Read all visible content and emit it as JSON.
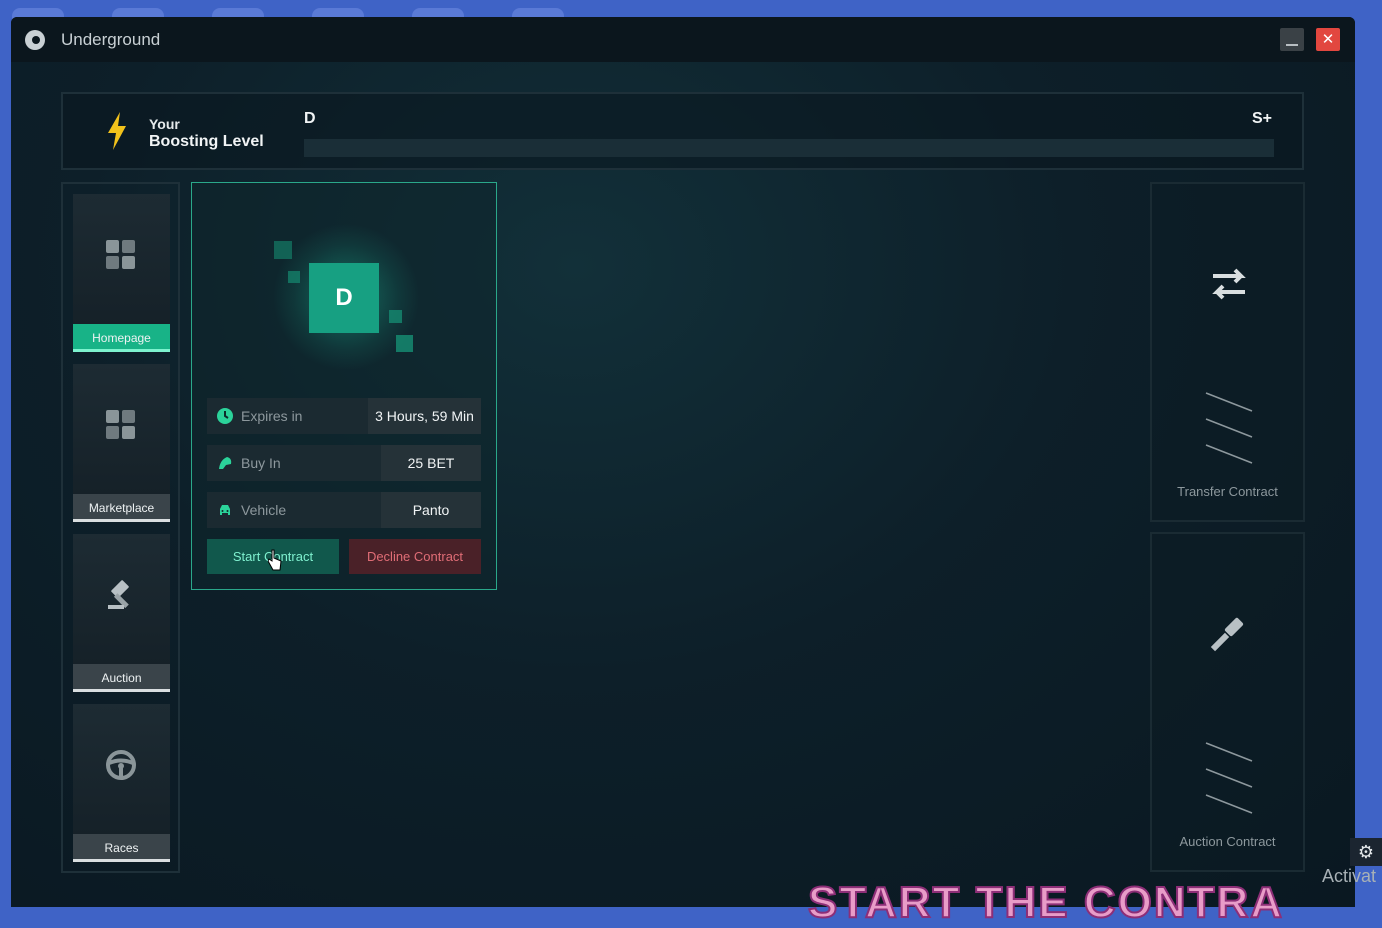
{
  "window": {
    "title": "Underground"
  },
  "boosting": {
    "label_your": "Your",
    "label_title": "Boosting Level",
    "current_level": "D",
    "max_level": "S+",
    "progress": 0.0
  },
  "sidebar": {
    "items": [
      {
        "label": "Homepage",
        "icon": "grid-icon",
        "active": true
      },
      {
        "label": "Marketplace",
        "icon": "grid-icon",
        "active": false
      },
      {
        "label": "Auction",
        "icon": "gavel-icon",
        "active": false
      },
      {
        "label": "Races",
        "icon": "steering-wheel-icon",
        "active": false
      }
    ]
  },
  "contract": {
    "tier": "D",
    "rows": [
      {
        "label": "Expires in",
        "value": "3 Hours, 59 Min",
        "icon": "clock-icon"
      },
      {
        "label": "Buy In",
        "value": "25 BET",
        "icon": "coin-icon"
      },
      {
        "label": "Vehicle",
        "value": "Panto",
        "icon": "car-icon"
      }
    ],
    "start_label": "Start Contract",
    "decline_label": "Decline Contract"
  },
  "side_actions": {
    "transfer_label": "Transfer Contract",
    "auction_label": "Auction Contract"
  },
  "overlay": {
    "caption": "START THE CONTRA",
    "watermark": "Activat"
  },
  "colors": {
    "accent": "#18b387",
    "decline": "#e06d76",
    "bolt": "#f2c21b"
  }
}
